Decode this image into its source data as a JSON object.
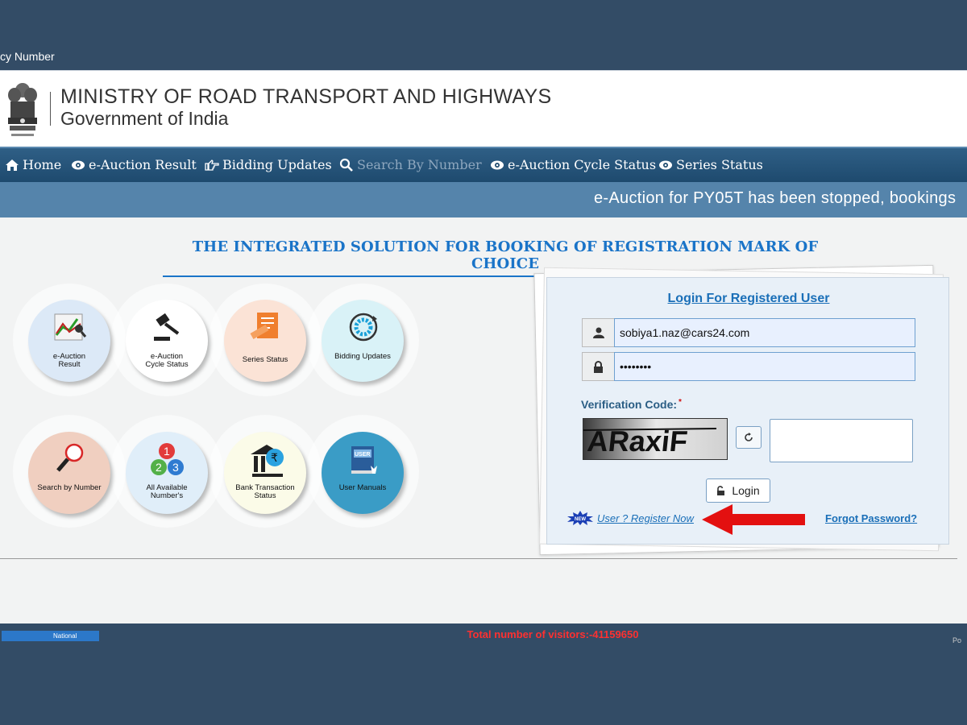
{
  "topbar": {
    "partial_text": "cy Number"
  },
  "header": {
    "title_line1": "MINISTRY OF ROAD TRANSPORT AND HIGHWAYS",
    "title_line2": "Government of India"
  },
  "nav": {
    "items": [
      {
        "label": "Home",
        "icon": "home-icon"
      },
      {
        "label": "e-Auction Result",
        "icon": "eye-icon"
      },
      {
        "label": "Bidding Updates",
        "icon": "hand-point-icon"
      },
      {
        "label": "Search By Number",
        "icon": "search-icon"
      },
      {
        "label": "e-Auction Cycle Status",
        "icon": "eye-icon"
      },
      {
        "label": "Series Status",
        "icon": "eye-icon"
      }
    ]
  },
  "ticker": {
    "text": "e-Auction for PY05T has been stopped, bookings"
  },
  "main": {
    "headline": "THE INTEGRATED SOLUTION FOR BOOKING OF REGISTRATION MARK OF CHOICE",
    "tiles": [
      {
        "line1": "e-Auction",
        "line2": "Result",
        "icon": "chart-icon"
      },
      {
        "line1": "e-Auction",
        "line2": "Cycle Status",
        "icon": "gavel-icon"
      },
      {
        "line1": "Series Status",
        "line2": "",
        "icon": "document-icon"
      },
      {
        "line1": "Bidding Updates",
        "line2": "",
        "icon": "refresh-cycle-icon"
      },
      {
        "line1": "Search by Number",
        "line2": "",
        "icon": "magnifier-icon"
      },
      {
        "line1": "All Available",
        "line2": "Number's",
        "icon": "numbers-icon"
      },
      {
        "line1": "Bank Transaction",
        "line2": "Status",
        "icon": "bank-icon"
      },
      {
        "line1": "User Manuals",
        "line2": "",
        "icon": "manual-book-icon"
      }
    ]
  },
  "login": {
    "title": "Login For Registered User",
    "username_value": "sobiya1.naz@cars24.com",
    "password_value": "••••••••",
    "verification_label": "Verification Code:",
    "required_mark": "*",
    "captcha_text": "ARaxiF",
    "captcha_input_value": "",
    "login_label": "Login",
    "new_badge": "NEW",
    "register_label": "User ? Register Now",
    "forgot_label": "Forgot Password?"
  },
  "footer": {
    "nic_label": "National",
    "visitors": "Total number of visitors:-41159650",
    "right_partial": "Po"
  },
  "colors": {
    "page_bg": "#334c66",
    "nav_bg": "#1e4a6e",
    "ticker_bg": "#5584ab",
    "link_blue": "#1a6fb8",
    "headline_blue": "#1a74c8",
    "visitor_red": "#ff3030",
    "arrow_red": "#e31010"
  }
}
